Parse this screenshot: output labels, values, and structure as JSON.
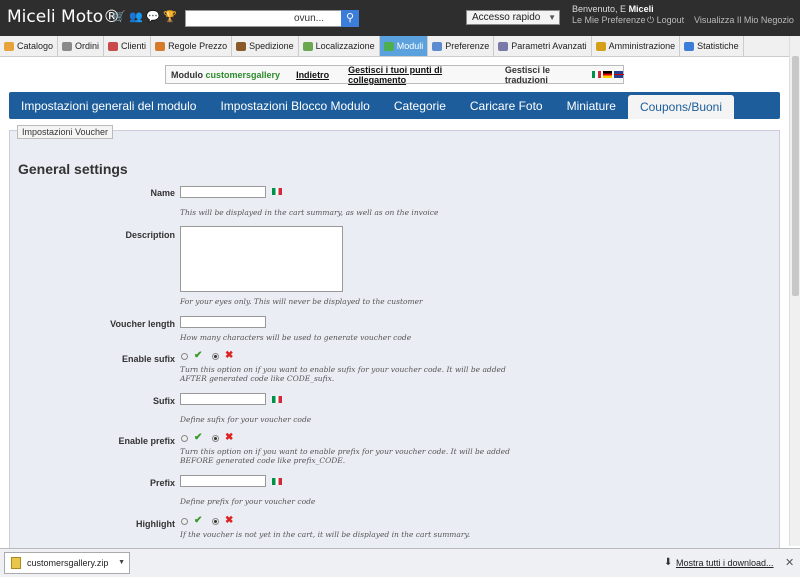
{
  "header": {
    "brand": "Miceli Moto®",
    "search_scope": "ovun...",
    "quick_access": "Accesso rapido",
    "welcome_prefix": "Benvenuto, E",
    "welcome_name": "Miceli",
    "preferences": "Le Mie Preferenze",
    "logout": "Logout",
    "view_shop": "Visualizza Il Mio Negozio"
  },
  "menu": {
    "items": [
      {
        "label": "Catalogo",
        "color": "#e8a33a"
      },
      {
        "label": "Ordini",
        "color": "#8a8a8a"
      },
      {
        "label": "Clienti",
        "color": "#c94a4a"
      },
      {
        "label": "Regole Prezzo",
        "color": "#d67a2a"
      },
      {
        "label": "Spedizione",
        "color": "#8a5a2a"
      },
      {
        "label": "Localizzazione",
        "color": "#6aa84f"
      },
      {
        "label": "Moduli",
        "color": "#4caf50"
      },
      {
        "label": "Preferenze",
        "color": "#5b8bd1"
      },
      {
        "label": "Parametri Avanzati",
        "color": "#7a7aa8"
      },
      {
        "label": "Amministrazione",
        "color": "#d4a017"
      },
      {
        "label": "Statistiche",
        "color": "#3b7dd8"
      }
    ]
  },
  "subnav": {
    "module_prefix": "Modulo",
    "module_name": "customersgallery",
    "back": "Indietro",
    "hook_points": "Gestisci i tuoi punti di collegamento",
    "translations": "Gestisci le traduzioni"
  },
  "tabs": [
    "Impostazioni generali del modulo",
    "Impostazioni Blocco Modulo",
    "Categorie",
    "Caricare Foto",
    "Miniature",
    "Coupons/Buoni"
  ],
  "form": {
    "legend": "Impostazioni Voucher",
    "section_title": "General settings",
    "name_label": "Name",
    "name_help": "This will be displayed in the cart summary, as well as on the invoice",
    "description_label": "Description",
    "description_help": "For your eyes only. This will never be displayed to the customer",
    "length_label": "Voucher length",
    "length_help": "How many characters will be used to generate voucher code",
    "sufix_toggle_label": "Enable sufix",
    "sufix_toggle_help_1": "Turn this option on if you want to enable sufix for your voucher code. It will be added",
    "sufix_toggle_help_2": "AFTER generated code like CODE_sufix.",
    "sufix_label": "Sufix",
    "sufix_help": "Define sufix for your voucher code",
    "prefix_toggle_label": "Enable prefix",
    "prefix_toggle_help_1": "Turn this option on if you want to enable prefix for your voucher code. It will be added",
    "prefix_toggle_help_2": "BEFORE generated code like prefix_CODE.",
    "prefix_label": "Prefix",
    "prefix_help": "Define prefix for your voucher code",
    "highlight_label": "Highlight",
    "highlight_help": "If the voucher is not yet in the cart, it will be displayed in the cart summary."
  },
  "downloads": {
    "file": "customersgallery.zip",
    "show_all": "Mostra tutti i download..."
  }
}
